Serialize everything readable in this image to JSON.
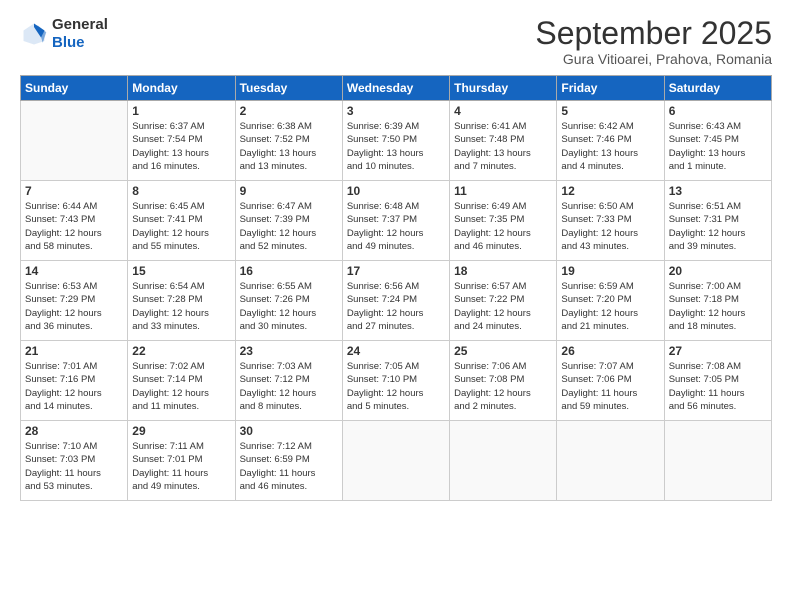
{
  "header": {
    "logo_general": "General",
    "logo_blue": "Blue",
    "month_year": "September 2025",
    "location": "Gura Vitioarei, Prahova, Romania"
  },
  "days_of_week": [
    "Sunday",
    "Monday",
    "Tuesday",
    "Wednesday",
    "Thursday",
    "Friday",
    "Saturday"
  ],
  "weeks": [
    [
      {
        "day": "",
        "info": ""
      },
      {
        "day": "1",
        "info": "Sunrise: 6:37 AM\nSunset: 7:54 PM\nDaylight: 13 hours\nand 16 minutes."
      },
      {
        "day": "2",
        "info": "Sunrise: 6:38 AM\nSunset: 7:52 PM\nDaylight: 13 hours\nand 13 minutes."
      },
      {
        "day": "3",
        "info": "Sunrise: 6:39 AM\nSunset: 7:50 PM\nDaylight: 13 hours\nand 10 minutes."
      },
      {
        "day": "4",
        "info": "Sunrise: 6:41 AM\nSunset: 7:48 PM\nDaylight: 13 hours\nand 7 minutes."
      },
      {
        "day": "5",
        "info": "Sunrise: 6:42 AM\nSunset: 7:46 PM\nDaylight: 13 hours\nand 4 minutes."
      },
      {
        "day": "6",
        "info": "Sunrise: 6:43 AM\nSunset: 7:45 PM\nDaylight: 13 hours\nand 1 minute."
      }
    ],
    [
      {
        "day": "7",
        "info": "Sunrise: 6:44 AM\nSunset: 7:43 PM\nDaylight: 12 hours\nand 58 minutes."
      },
      {
        "day": "8",
        "info": "Sunrise: 6:45 AM\nSunset: 7:41 PM\nDaylight: 12 hours\nand 55 minutes."
      },
      {
        "day": "9",
        "info": "Sunrise: 6:47 AM\nSunset: 7:39 PM\nDaylight: 12 hours\nand 52 minutes."
      },
      {
        "day": "10",
        "info": "Sunrise: 6:48 AM\nSunset: 7:37 PM\nDaylight: 12 hours\nand 49 minutes."
      },
      {
        "day": "11",
        "info": "Sunrise: 6:49 AM\nSunset: 7:35 PM\nDaylight: 12 hours\nand 46 minutes."
      },
      {
        "day": "12",
        "info": "Sunrise: 6:50 AM\nSunset: 7:33 PM\nDaylight: 12 hours\nand 43 minutes."
      },
      {
        "day": "13",
        "info": "Sunrise: 6:51 AM\nSunset: 7:31 PM\nDaylight: 12 hours\nand 39 minutes."
      }
    ],
    [
      {
        "day": "14",
        "info": "Sunrise: 6:53 AM\nSunset: 7:29 PM\nDaylight: 12 hours\nand 36 minutes."
      },
      {
        "day": "15",
        "info": "Sunrise: 6:54 AM\nSunset: 7:28 PM\nDaylight: 12 hours\nand 33 minutes."
      },
      {
        "day": "16",
        "info": "Sunrise: 6:55 AM\nSunset: 7:26 PM\nDaylight: 12 hours\nand 30 minutes."
      },
      {
        "day": "17",
        "info": "Sunrise: 6:56 AM\nSunset: 7:24 PM\nDaylight: 12 hours\nand 27 minutes."
      },
      {
        "day": "18",
        "info": "Sunrise: 6:57 AM\nSunset: 7:22 PM\nDaylight: 12 hours\nand 24 minutes."
      },
      {
        "day": "19",
        "info": "Sunrise: 6:59 AM\nSunset: 7:20 PM\nDaylight: 12 hours\nand 21 minutes."
      },
      {
        "day": "20",
        "info": "Sunrise: 7:00 AM\nSunset: 7:18 PM\nDaylight: 12 hours\nand 18 minutes."
      }
    ],
    [
      {
        "day": "21",
        "info": "Sunrise: 7:01 AM\nSunset: 7:16 PM\nDaylight: 12 hours\nand 14 minutes."
      },
      {
        "day": "22",
        "info": "Sunrise: 7:02 AM\nSunset: 7:14 PM\nDaylight: 12 hours\nand 11 minutes."
      },
      {
        "day": "23",
        "info": "Sunrise: 7:03 AM\nSunset: 7:12 PM\nDaylight: 12 hours\nand 8 minutes."
      },
      {
        "day": "24",
        "info": "Sunrise: 7:05 AM\nSunset: 7:10 PM\nDaylight: 12 hours\nand 5 minutes."
      },
      {
        "day": "25",
        "info": "Sunrise: 7:06 AM\nSunset: 7:08 PM\nDaylight: 12 hours\nand 2 minutes."
      },
      {
        "day": "26",
        "info": "Sunrise: 7:07 AM\nSunset: 7:06 PM\nDaylight: 11 hours\nand 59 minutes."
      },
      {
        "day": "27",
        "info": "Sunrise: 7:08 AM\nSunset: 7:05 PM\nDaylight: 11 hours\nand 56 minutes."
      }
    ],
    [
      {
        "day": "28",
        "info": "Sunrise: 7:10 AM\nSunset: 7:03 PM\nDaylight: 11 hours\nand 53 minutes."
      },
      {
        "day": "29",
        "info": "Sunrise: 7:11 AM\nSunset: 7:01 PM\nDaylight: 11 hours\nand 49 minutes."
      },
      {
        "day": "30",
        "info": "Sunrise: 7:12 AM\nSunset: 6:59 PM\nDaylight: 11 hours\nand 46 minutes."
      },
      {
        "day": "",
        "info": ""
      },
      {
        "day": "",
        "info": ""
      },
      {
        "day": "",
        "info": ""
      },
      {
        "day": "",
        "info": ""
      }
    ]
  ]
}
